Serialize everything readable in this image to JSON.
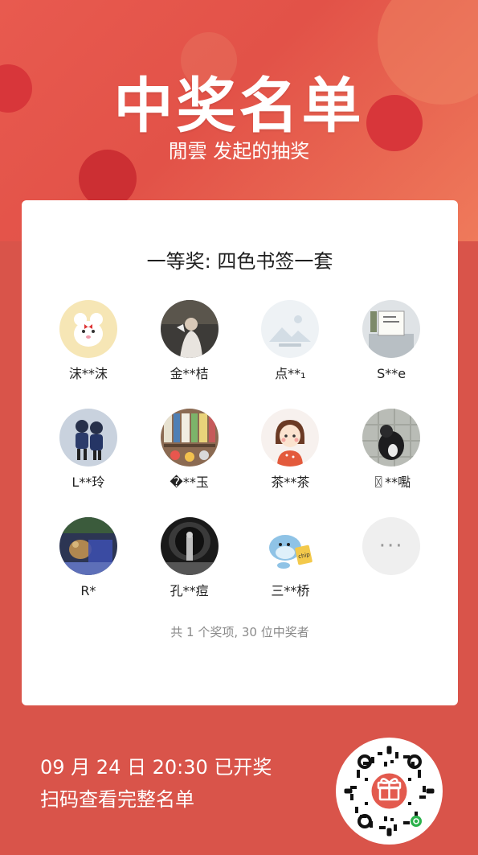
{
  "header": {
    "title": "中奖名单",
    "subtitle": "閒雲 发起的抽奖"
  },
  "prize": {
    "title": "一等奖: 四色书签一套"
  },
  "winners": [
    {
      "name": "沫**沫",
      "avatar": "bear-avatar"
    },
    {
      "name": "金**桔",
      "avatar": "photo-avatar-dark"
    },
    {
      "name": "点**₁",
      "avatar": "placeholder-avatar"
    },
    {
      "name": "S**e",
      "avatar": "photo-avatar-light"
    },
    {
      "name": "L**玲",
      "avatar": "dolls-avatar"
    },
    {
      "name": "�**玉",
      "avatar": "shelf-avatar"
    },
    {
      "name": "茶**茶",
      "avatar": "girl-cartoon-avatar"
    },
    {
      "name": "〿**嚸",
      "avatar": "toy-avatar"
    },
    {
      "name": "R*",
      "avatar": "night-photo-avatar"
    },
    {
      "name": "孔**痘",
      "avatar": "bw-photo-avatar"
    },
    {
      "name": "三**桥",
      "avatar": "dolphin-cartoon-avatar"
    }
  ],
  "more": {
    "label": "···",
    "icon": "more-icon"
  },
  "summary": "共 1 个奖项, 30 位中奖者",
  "footer": {
    "draw_time": "09 月 24 日 20:30 已开奖",
    "scan_hint": "扫码查看完整名单"
  },
  "qr": {
    "icon": "gift-icon",
    "badge_icon": "mini-program-icon"
  },
  "colors": {
    "accent": "#d9544a",
    "card": "#ffffff"
  }
}
